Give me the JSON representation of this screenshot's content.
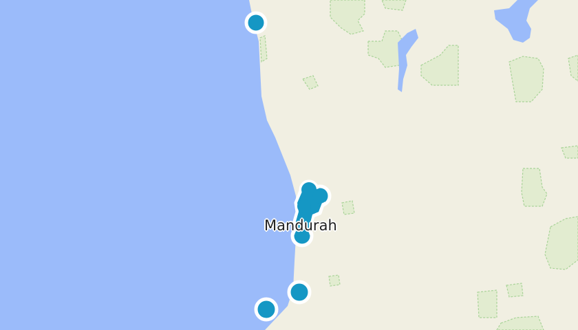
{
  "map": {
    "label_text": "Mandurah",
    "colors": {
      "water": "#9bbbfa",
      "land": "#f1efe2",
      "park_fill": "#e2ecd0",
      "park_outline": "#a9d398",
      "lake": "#9bbbfa",
      "marker_fill": "#1597c4",
      "marker_stroke": "#ffffff"
    },
    "marker_icon": "circle-marker",
    "markers_count": 8
  }
}
